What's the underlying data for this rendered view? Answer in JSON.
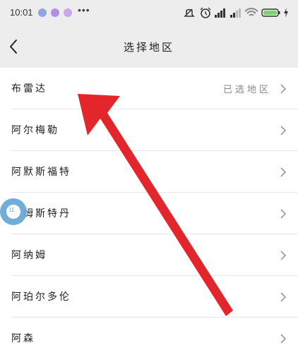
{
  "status_bar": {
    "time": "10:01",
    "more": "•••",
    "icons_left": [
      "app-notification-icon",
      "app-notification-icon",
      "app-notification-icon"
    ],
    "icons_right": [
      "mute-icon",
      "alarm-icon",
      "cell-signal-icon",
      "cell-signal-icon",
      "wifi-icon",
      "battery-icon",
      "charging-icon"
    ],
    "battery_color": "#7bd36b"
  },
  "nav": {
    "title": "选择地区",
    "back_icon": "chevron-left-icon"
  },
  "regions": [
    {
      "label": "布雷达",
      "hint": "已选地区"
    },
    {
      "label": "阿尔梅勒",
      "hint": ""
    },
    {
      "label": "阿默斯福特",
      "hint": ""
    },
    {
      "label": "阿姆斯特丹",
      "hint": ""
    },
    {
      "label": "阿纳姆",
      "hint": ""
    },
    {
      "label": "阿珀尔多伦",
      "hint": ""
    },
    {
      "label": "阿森",
      "hint": ""
    }
  ],
  "floating_ball": {
    "text": "11",
    "color": "#6aa9d8"
  },
  "annotation": {
    "type": "red-arrow",
    "color": "#e3262b"
  }
}
